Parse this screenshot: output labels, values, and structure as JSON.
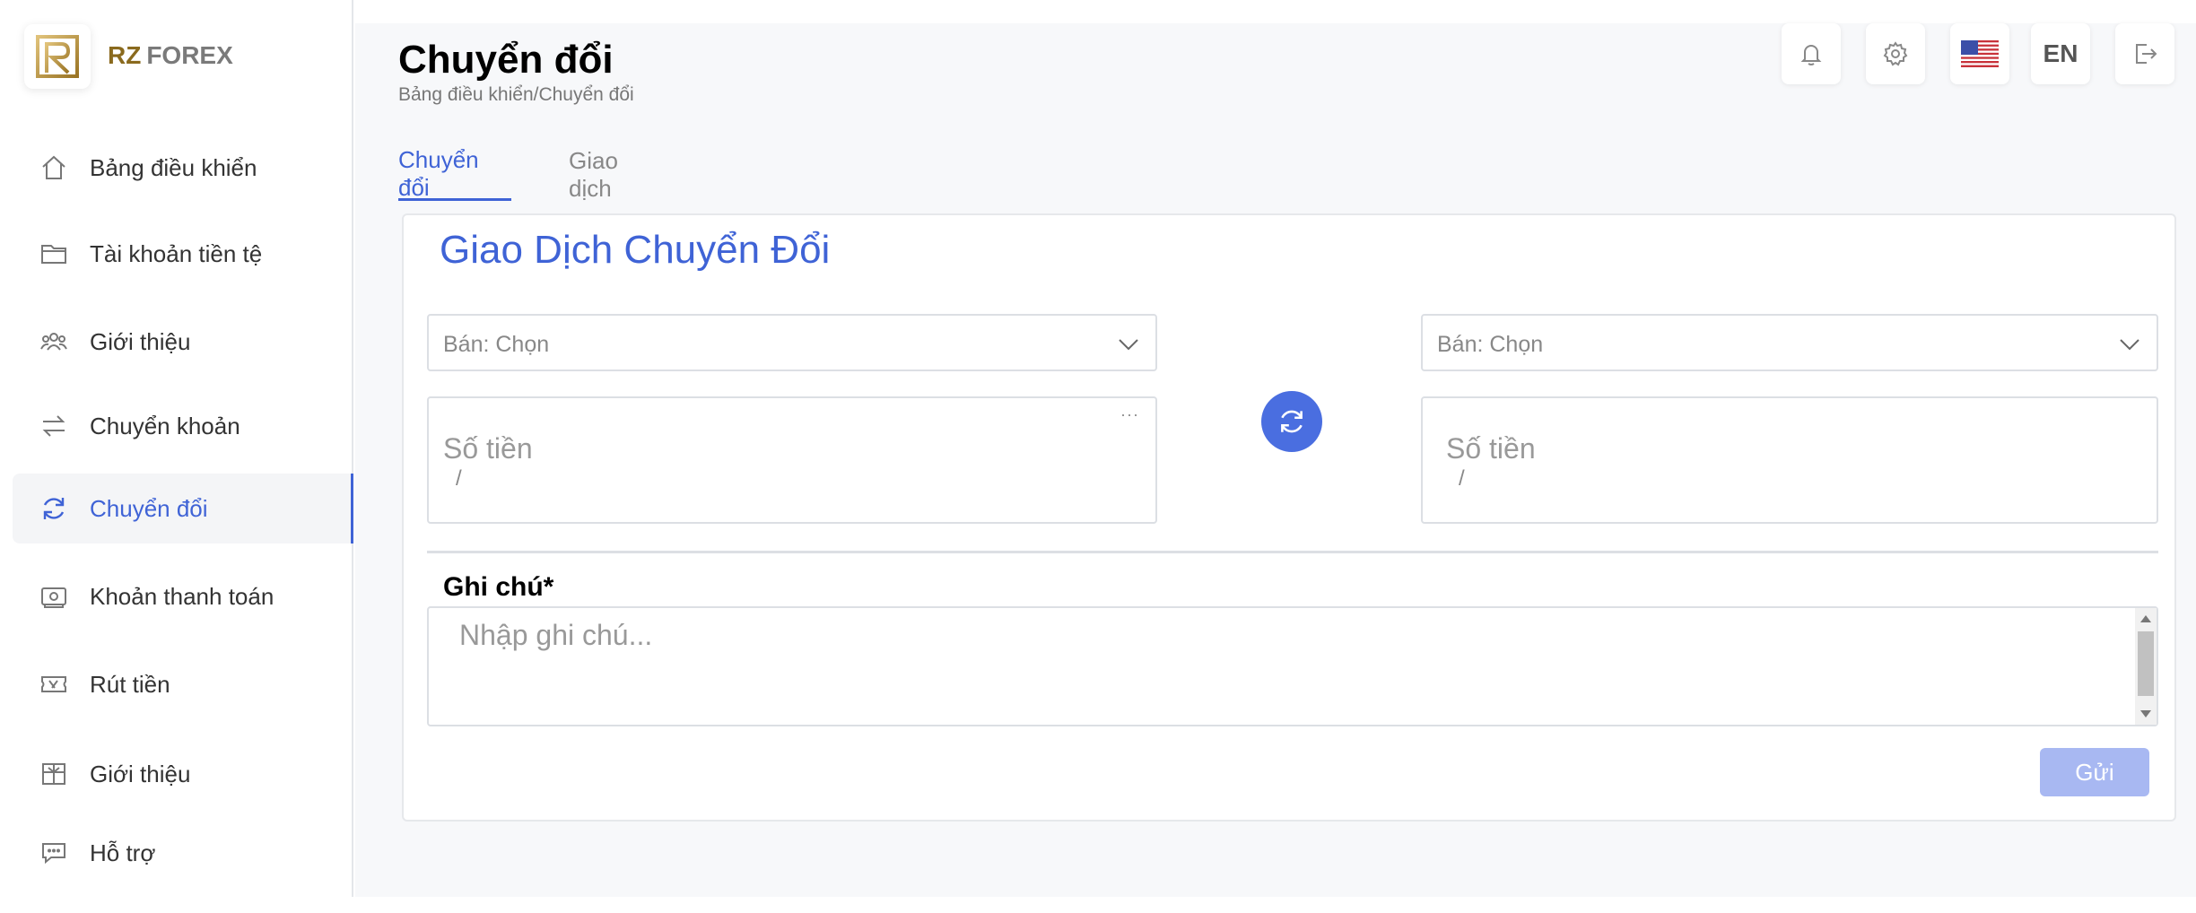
{
  "brand": {
    "short": "RZ",
    "name": "FOREX"
  },
  "sidebar": {
    "items": [
      {
        "label": "Bảng điều khiển",
        "icon": "home-icon"
      },
      {
        "label": "Tài khoản tiền tệ",
        "icon": "folder-icon"
      },
      {
        "label": "Giới thiệu",
        "icon": "users-icon"
      },
      {
        "label": "Chuyển khoản",
        "icon": "transfer-arrows-icon"
      },
      {
        "label": "Chuyển đổi",
        "icon": "refresh-icon",
        "active": true
      },
      {
        "label": "Khoản thanh toán",
        "icon": "money-icon"
      },
      {
        "label": "Rút tiền",
        "icon": "ticket-icon"
      },
      {
        "label": "Giới thiệu",
        "icon": "gift-icon"
      },
      {
        "label": "Hỗ trợ",
        "icon": "chat-icon"
      }
    ]
  },
  "header": {
    "title": "Chuyển đổi",
    "breadcrumb": "Bảng điều khiển/Chuyển đổi",
    "language": "EN",
    "icons": [
      "bell-icon",
      "gear-icon",
      "us-flag-icon",
      "logout-icon"
    ]
  },
  "tabs": [
    {
      "label": "Chuyển đổi",
      "active": true
    },
    {
      "label": "Giao dịch",
      "active": false
    }
  ],
  "form": {
    "title": "Giao Dịch Chuyển Đổi",
    "left_select": "Bán: Chọn",
    "right_select": "Bán: Chọn",
    "left_amount_placeholder": "Số tiền",
    "right_amount_placeholder": "Số tiền",
    "left_amount_sub": "/",
    "right_amount_sub": "/",
    "more": "···",
    "note_label": "Ghi chú*",
    "note_placeholder": "Nhập ghi chú...",
    "submit": "Gửi"
  },
  "colors": {
    "accent": "#3f63d6",
    "swap_button": "#4a6ee0",
    "submit_disabled": "#a8b8f2",
    "brand_gold": "#8a6a1e"
  }
}
